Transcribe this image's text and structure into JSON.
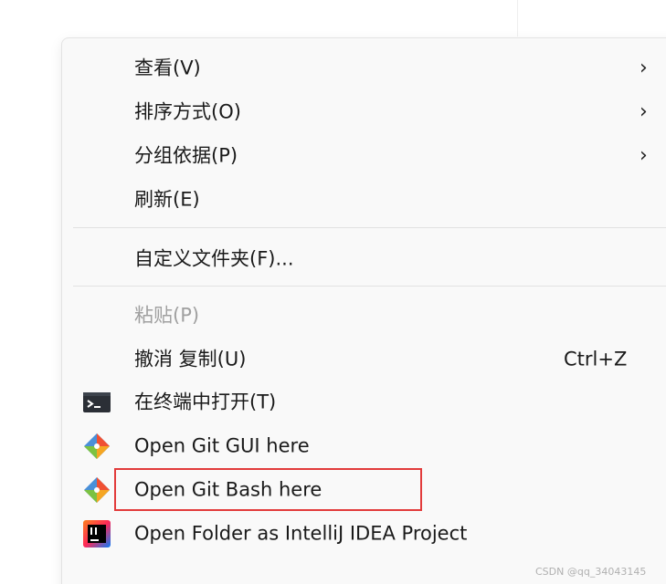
{
  "context_menu": {
    "items": [
      {
        "label": "查看(V)",
        "submenu": true,
        "disabled": false
      },
      {
        "label": "排序方式(O)",
        "submenu": true,
        "disabled": false
      },
      {
        "label": "分组依据(P)",
        "submenu": true,
        "disabled": false
      },
      {
        "label": "刷新(E)",
        "submenu": false,
        "disabled": false
      },
      {
        "label": "自定义文件夹(F)...",
        "submenu": false,
        "disabled": false
      },
      {
        "label": "粘贴(P)",
        "submenu": false,
        "disabled": true
      },
      {
        "label": "撤消 复制(U)",
        "shortcut": "Ctrl+Z",
        "submenu": false,
        "disabled": false
      },
      {
        "label": "在终端中打开(T)",
        "icon": "terminal-icon",
        "submenu": false,
        "disabled": false
      },
      {
        "label": "Open Git GUI here",
        "icon": "git-icon",
        "submenu": false,
        "disabled": false
      },
      {
        "label": "Open Git Bash here",
        "icon": "git-icon",
        "submenu": false,
        "disabled": false,
        "highlighted": true
      },
      {
        "label": "Open Folder as IntelliJ IDEA Project",
        "icon": "intellij-icon",
        "submenu": false,
        "disabled": false
      }
    ],
    "chevron_glyph": "›"
  },
  "highlight_color": "#e23b3b",
  "watermark": "CSDN @qq_34043145"
}
